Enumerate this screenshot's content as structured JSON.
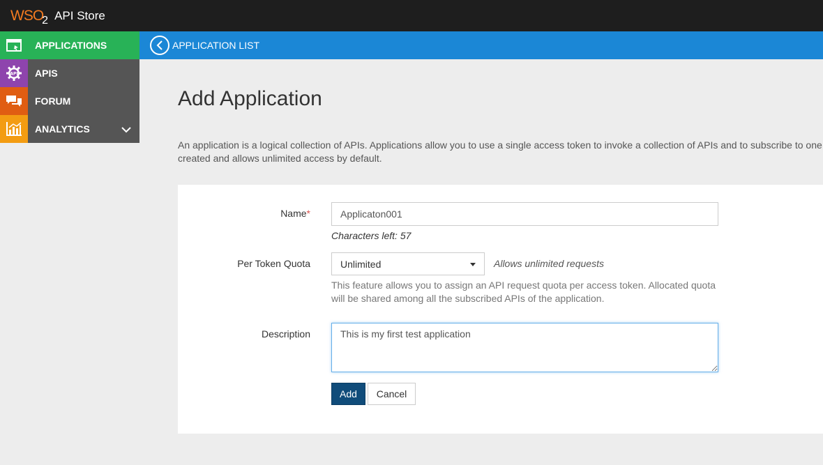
{
  "header": {
    "brand": "WSO",
    "brand_sub": "2",
    "title": "API Store"
  },
  "sidebar": {
    "items": [
      {
        "label": "APPLICATIONS",
        "icon": "window-icon",
        "color": "#28b257"
      },
      {
        "label": "APIS",
        "icon": "api-gear-icon",
        "color": "#8e44ad"
      },
      {
        "label": "FORUM",
        "icon": "chat-icon",
        "color": "#e05d12"
      },
      {
        "label": "ANALYTICS",
        "icon": "bar-chart-icon",
        "color": "#f39c12"
      }
    ]
  },
  "breadcrumb": {
    "label": "APPLICATION LIST"
  },
  "main": {
    "title": "Add Application",
    "intro_line1": "An application is a logical collection of APIs. Applications allow you to use a single access token to invoke a collection of APIs and to subscribe to one API",
    "intro_line2": "created and allows unlimited access by default."
  },
  "form": {
    "name_label": "Name",
    "name_required": "*",
    "name_value": "Applicaton001",
    "chars_left": "Characters left: 57",
    "quota_label": "Per Token Quota",
    "quota_value": "Unlimited",
    "quota_note": "Allows unlimited requests",
    "quota_help": "This feature allows you to assign an API request quota per access token. Allocated quota will be shared among all the subscribed APIs of the application.",
    "description_label": "Description",
    "description_value": "This is my first test application",
    "add_label": "Add",
    "cancel_label": "Cancel"
  }
}
